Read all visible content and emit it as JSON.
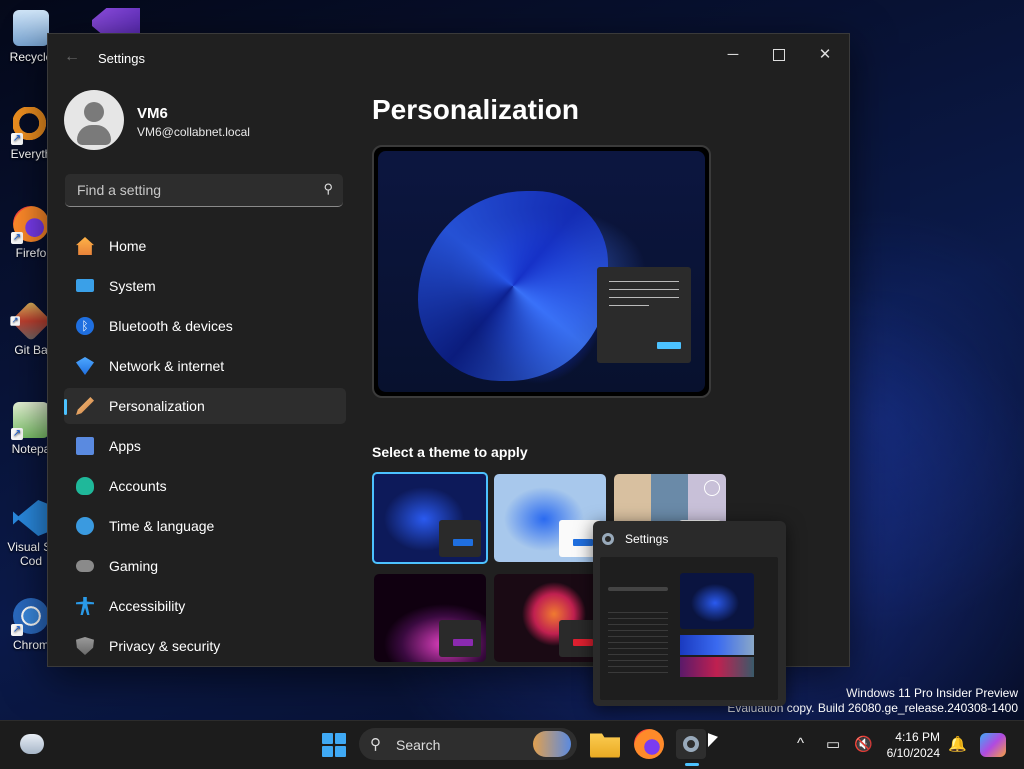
{
  "desktop": {
    "icons": [
      {
        "label": "Recycle",
        "icon": "recycle-bin-icon",
        "color": "#9fc4e8"
      },
      {
        "label": "Everyth",
        "icon": "everything-search-icon",
        "color": "#f09020"
      },
      {
        "label": "Firefo",
        "icon": "firefox-icon",
        "color": "#ff7a2a"
      },
      {
        "label": "Git Ba",
        "icon": "git-bash-icon",
        "color": "#d04030"
      },
      {
        "label": "Notepa",
        "icon": "notepad-icon",
        "color": "#5cb85c"
      },
      {
        "label": "Visual St\nCod",
        "icon": "vscode-icon",
        "color": "#2a8ae0"
      },
      {
        "label": "Chrom",
        "icon": "chrome-icon",
        "color": "#2a7ad0"
      }
    ]
  },
  "window": {
    "title": "Settings",
    "back_icon": "back-arrow-icon",
    "controls": {
      "minimize": "─",
      "maximize": "",
      "close": "✕"
    }
  },
  "profile": {
    "name": "VM6",
    "email": "VM6@collabnet.local"
  },
  "search": {
    "placeholder": "Find a setting",
    "value": ""
  },
  "nav": {
    "items": [
      {
        "label": "Home",
        "icon": "home-icon"
      },
      {
        "label": "System",
        "icon": "system-icon"
      },
      {
        "label": "Bluetooth & devices",
        "icon": "bluetooth-icon"
      },
      {
        "label": "Network & internet",
        "icon": "network-icon"
      },
      {
        "label": "Personalization",
        "icon": "brush-icon",
        "active": true
      },
      {
        "label": "Apps",
        "icon": "apps-icon"
      },
      {
        "label": "Accounts",
        "icon": "accounts-icon"
      },
      {
        "label": "Time & language",
        "icon": "time-language-icon"
      },
      {
        "label": "Gaming",
        "icon": "gaming-icon"
      },
      {
        "label": "Accessibility",
        "icon": "accessibility-icon"
      },
      {
        "label": "Privacy & security",
        "icon": "shield-icon"
      }
    ]
  },
  "main": {
    "title": "Personalization",
    "theme_heading": "Select a theme to apply",
    "themes": [
      {
        "name": "windows-dark",
        "bg": "#0d1a5a",
        "accent": "#1f6fe0",
        "selected": true
      },
      {
        "name": "windows-light",
        "bg": "#9fc0e8",
        "accent": "#1f6fe0"
      },
      {
        "name": "windows-spotlight",
        "bg": "#c8b8a8",
        "accent": "#1f6fe0"
      },
      {
        "name": "glow",
        "bg": "#3a0a40",
        "accent": "#8a2ab0"
      },
      {
        "name": "captured-motion",
        "bg": "#1a0a14",
        "accent": "#e02030"
      }
    ]
  },
  "thumbnail_popup": {
    "title": "Settings"
  },
  "watermark": {
    "line1": "Windows 11 Pro Insider Preview",
    "line2": "Evaluation copy. Build 26080.ge_release.240308-1400"
  },
  "taskbar": {
    "search_label": "Search",
    "apps": [
      "file-explorer-icon",
      "firefox-icon",
      "settings-icon"
    ],
    "time": "4:16 PM",
    "date": "6/10/2024",
    "tray_icons": [
      "chevron-up-icon",
      "display-icon",
      "volume-muted-icon",
      "bell-icon"
    ]
  },
  "colors": {
    "accent": "#4cc2ff",
    "window_bg": "#202020"
  }
}
